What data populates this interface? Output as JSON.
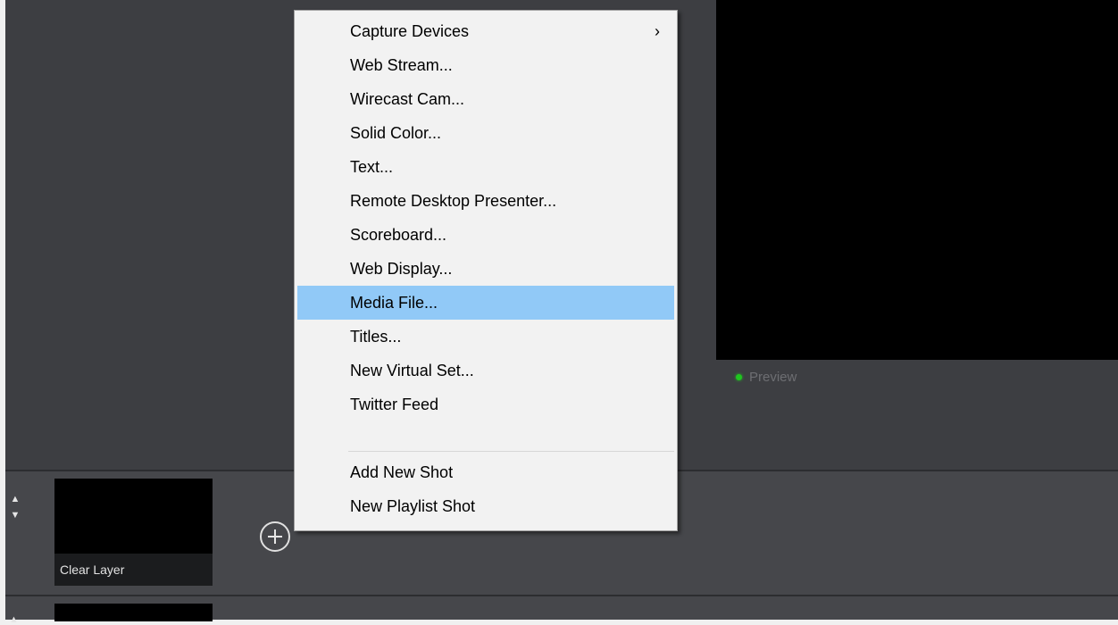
{
  "preview": {
    "label": "Preview",
    "status_color": "#1fc51f"
  },
  "layers": {
    "move_up_icon": "▲",
    "move_down_icon": "▼",
    "shot": {
      "label": "Clear Layer"
    },
    "add_button_icon": "plus-circle-icon"
  },
  "context_menu": {
    "items": [
      {
        "label": "Capture Devices",
        "has_submenu": true,
        "submenu_icon": "›"
      },
      {
        "label": "Web Stream..."
      },
      {
        "label": "Wirecast Cam..."
      },
      {
        "label": "Solid Color..."
      },
      {
        "label": "Text..."
      },
      {
        "label": "Remote Desktop Presenter..."
      },
      {
        "label": "Scoreboard..."
      },
      {
        "label": "Web Display..."
      },
      {
        "label": "Media File...",
        "highlighted": true
      },
      {
        "label": "Titles..."
      },
      {
        "label": "New Virtual Set..."
      },
      {
        "label": "Twitter Feed"
      },
      {
        "label": "Add New Shot"
      },
      {
        "label": "New Playlist Shot"
      }
    ]
  },
  "colors": {
    "menu_highlight": "#91c9f7",
    "app_background": "#3d3e42"
  }
}
